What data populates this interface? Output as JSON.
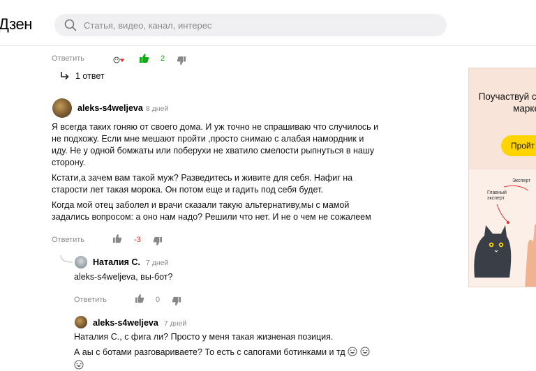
{
  "header": {
    "logo": "Дзен",
    "search_placeholder": "Статья, видео, канал, интерес"
  },
  "top_comment": {
    "reply_label": "Ответить",
    "likes": "2",
    "replies_label": "1 ответ"
  },
  "comment1": {
    "author": "aleks-s4weljeva",
    "date": "8 дней",
    "lines": [
      "Я всегда таких гоняю от своего дома. И уж точно не спрашиваю что случилось и",
      "не подхожу. Если мне мешают пройти ,просто снимаю с алабая намордник и",
      "иду. Не у одной бомжаты или поберухи не хватило смелости рыпнуться в нашу",
      "сторону.",
      "Кстати,а зачем вам такой муж? Разведитесь и живите для себя. Нафиг на",
      "старости лет такая морока. Он потом еще и гадить под себя будет.",
      "Когда мой отец заболел и врачи сказали такую альтернативу,мы с мамой",
      "задались вопросом: а оно нам надо? Решили что нет. И не о чем не сожалеем"
    ],
    "reply_label": "Ответить",
    "likes": "-3"
  },
  "comment2": {
    "author": "Наталия С.",
    "date": "7 дней",
    "text": "aleks-s4weljeva, вы-бот?",
    "reply_label": "Ответить",
    "likes": "0"
  },
  "comment3": {
    "author": "aleks-s4weljeva",
    "date": "7 дней",
    "lines": [
      "Наталия С., с фига ли? Просто у меня такая жизненая позиция.",
      "А аы с ботами разговариваете? То есть с сапогами ботинками и тд"
    ]
  },
  "ad": {
    "headline": "Поучаствуй среди экс марке",
    "button_label": "Пройт",
    "label_expert": "Эксперт",
    "label_main_expert": "Главный эксперт"
  },
  "colors": {
    "positive": "#16a81a",
    "negative": "#e0312f",
    "muted": "#8a8a8a",
    "ad_button": "#ffd400"
  }
}
